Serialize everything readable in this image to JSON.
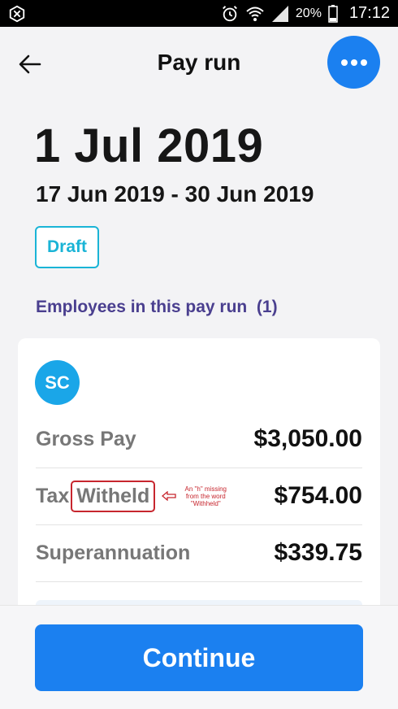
{
  "status_bar": {
    "battery": "20%",
    "time": "17:12",
    "icons": [
      "app-icon",
      "alarm-icon",
      "wifi-icon",
      "signal-icon",
      "battery-icon"
    ]
  },
  "header": {
    "title": "Pay run",
    "back_icon": "arrow-left-icon",
    "more_icon": "more-horizontal-icon"
  },
  "pay_run": {
    "date": "1 Jul 2019",
    "period": "17 Jun 2019 - 30 Jun 2019",
    "status": "Draft"
  },
  "employees_section": {
    "heading": "Employees in this pay run  (1)"
  },
  "employee": {
    "initials": "SC",
    "rows": [
      {
        "label": "Gross Pay",
        "value": "$3,050.00"
      },
      {
        "label_prefix": "Tax",
        "label_highlight": "Witheld",
        "value": "$754.00"
      },
      {
        "label": "Superannuation",
        "value": "$339.75"
      }
    ],
    "annotation": {
      "line1": "An \"h\" missing",
      "line2": "from the word",
      "line3": "\"Withheld\""
    }
  },
  "footer": {
    "continue_label": "Continue"
  },
  "colors": {
    "primary": "#1b80f0",
    "badge": "#1ab4d6",
    "heading": "#4a3f8f",
    "annotation": "#c7262e"
  }
}
